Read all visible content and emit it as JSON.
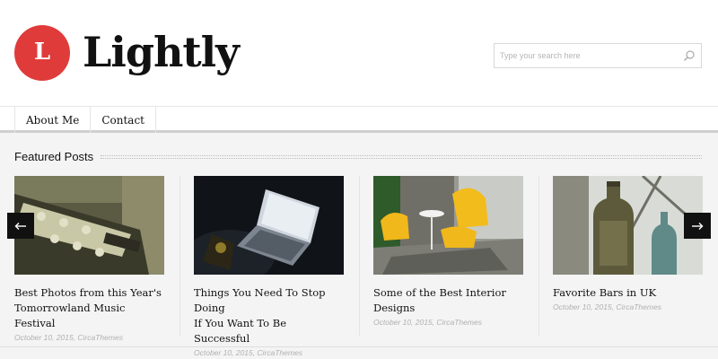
{
  "site": {
    "logo_letter": "L",
    "title": "Lightly"
  },
  "search": {
    "placeholder": "Type your search here"
  },
  "nav": {
    "items": [
      {
        "label": "About Me"
      },
      {
        "label": "Contact"
      }
    ]
  },
  "featured": {
    "heading": "Featured Posts",
    "posts": [
      {
        "title_line1": "Best Photos from this Year's",
        "title_line2": "Tomorrowland Music Festival",
        "meta": "October 10, 2015, CircaThemes"
      },
      {
        "title_line1": "Things You Need To Stop Doing",
        "title_line2": "If You Want To Be Successful",
        "meta": "October 10, 2015, CircaThemes"
      },
      {
        "title_line1": "Some of the Best Interior",
        "title_line2": "Designs",
        "meta": "October 10, 2015, CircaThemes"
      },
      {
        "title_line1": "Favorite Bars in UK",
        "title_line2": "",
        "meta": "October 10, 2015, CircaThemes"
      }
    ]
  },
  "carousel": {
    "prev_icon": "arrow-left-icon",
    "next_icon": "arrow-right-icon"
  },
  "colors": {
    "brand_red": "#e03b3b",
    "arrow_bg": "#111111"
  }
}
